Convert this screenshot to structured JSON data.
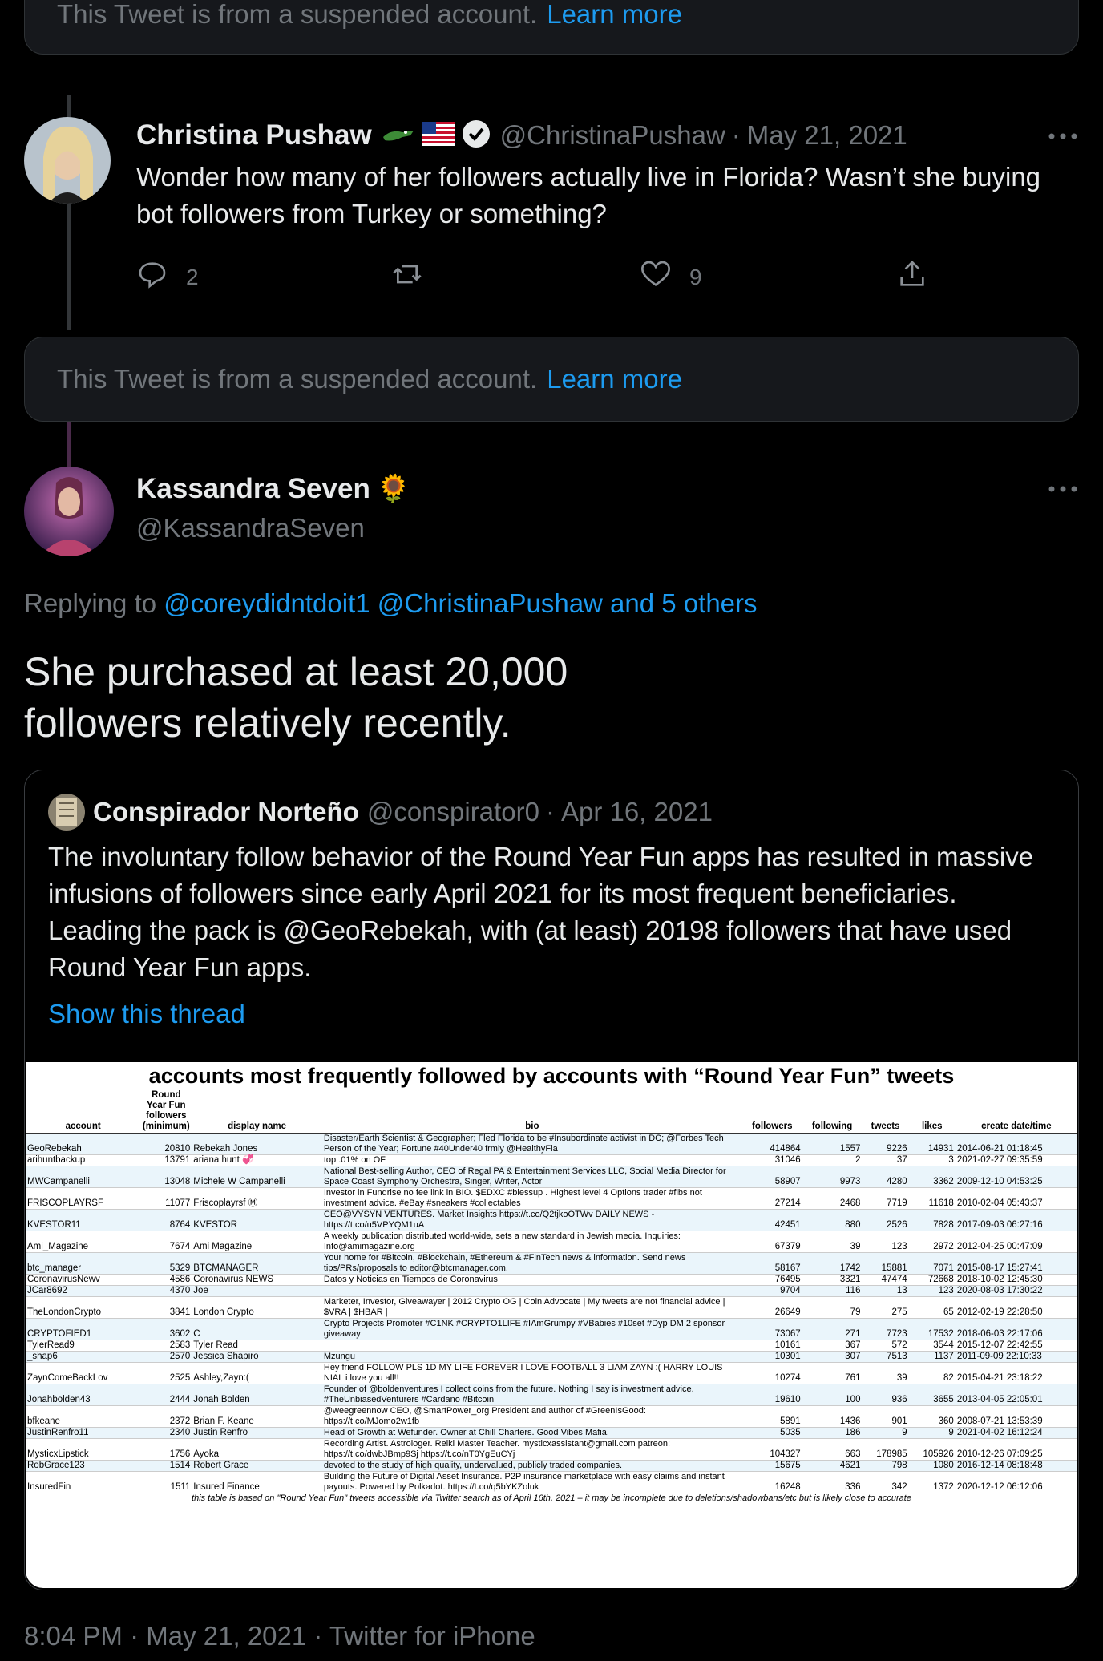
{
  "suspended_notice": {
    "text": "This Tweet is from a suspended account.",
    "link": "Learn more"
  },
  "tweet1": {
    "name": "Christina Pushaw",
    "handle": "@ChristinaPushaw",
    "date": "May 21, 2021",
    "text": "Wonder how many of her followers actually live in Florida? Wasn’t she buying bot followers from Turkey or something?",
    "replies": "2",
    "likes": "9"
  },
  "tweet2": {
    "name": "Kassandra Seven",
    "emoji": "🌻",
    "handle": "@KassandraSeven",
    "replying_label": "Replying to",
    "replying_to": "@coreydidntdoit1 @ChristinaPushaw and 5 others",
    "text_line1": "She purchased at least 20,000",
    "text_line2": "followers relatively recently.",
    "timestamp": "8:04 PM · May 21, 2021 · Twitter for iPhone"
  },
  "quote": {
    "name": "Conspirador Norteño",
    "handle": "@conspirator0",
    "date": "Apr 16, 2021",
    "text": "The involuntary follow behavior of the Round Year Fun apps has resulted in massive infusions of followers since early April 2021 for its most frequent beneficiaries. Leading the pack is @GeoRebekah, with (at least) 20198 followers that have used Round Year Fun apps.",
    "show_thread": "Show this thread"
  },
  "table": {
    "title": "accounts most frequently followed by accounts with “Round Year Fun” tweets",
    "headers": [
      "account",
      "Round Year Fun followers (minimum)",
      "display name",
      "bio",
      "followers",
      "following",
      "tweets",
      "likes",
      "create date/time"
    ],
    "rows": [
      [
        "GeoRebekah",
        "20810",
        "Rebekah Jones",
        "Disaster/Earth Scientist & Geographer; Fled Florida to be #Insubordinate activist in DC; @Forbes Tech Person of the Year; Fortune #40Under40 frmly @HealthyFla",
        "414864",
        "1557",
        "9226",
        "14931",
        "2014-06-21 01:18:45"
      ],
      [
        "arihuntbackup",
        "13791",
        "ariana hunt 💞",
        "top .01% on OF",
        "31046",
        "2",
        "37",
        "3",
        "2021-02-27 09:35:59"
      ],
      [
        "MWCampanelli",
        "13048",
        "Michele W Campanelli",
        "National Best-selling Author, CEO of Regal PA & Entertainment Services LLC, Social Media Director for Space Coast Symphony Orchestra, Singer, Writer, Actor",
        "58907",
        "9973",
        "4280",
        "3362",
        "2009-12-10 04:53:25"
      ],
      [
        "FRISCOPLAYRSF",
        "11077",
        "Friscoplayrsf Ⓜ",
        "Investor in Fundrise no fee link in BIO. $EDXC #blessup . Highest level 4 Options trader #fibs not investment advice. #eBay #sneakers #collectables",
        "27214",
        "2468",
        "7719",
        "11618",
        "2010-02-04 05:43:37"
      ],
      [
        "KVESTOR11",
        "8764",
        "KVESTOR",
        "CEO@VYSYN VENTURES. Market Insights https://t.co/Q2tjkoOTWv DAILY NEWS - https://t.co/u5VPYQM1uA",
        "42451",
        "880",
        "2526",
        "7828",
        "2017-09-03 06:27:16"
      ],
      [
        "Ami_Magazine",
        "7674",
        "Ami Magazine",
        "A weekly publication distributed world-wide, sets a new standard in Jewish media. Inquiries: Info@amimagazine.org",
        "67379",
        "39",
        "123",
        "2972",
        "2012-04-25 00:47:09"
      ],
      [
        "btc_manager",
        "5329",
        "BTCMANAGER",
        "Your home for #Bitcoin, #Blockchain, #Ethereum & #FinTech news & information. Send news tips/PRs/proposals to editor@btcmanager.com.",
        "58167",
        "1742",
        "15881",
        "7071",
        "2015-08-17 15:27:41"
      ],
      [
        "CoronavirusNewv",
        "4586",
        "Coronavirus NEWS",
        "Datos y Noticias en Tiempos de Coronavirus",
        "76495",
        "3321",
        "47474",
        "72668",
        "2018-10-02 12:45:30"
      ],
      [
        "JCar8692",
        "4370",
        "Joe",
        "",
        "9704",
        "116",
        "13",
        "123",
        "2020-08-03 17:30:22"
      ],
      [
        "TheLondonCrypto",
        "3841",
        "London Crypto",
        "Marketer, Investor, Giveawayer | 2012 Crypto OG | Coin Advocate | My tweets are not financial advice | $VRA | $HBAR |",
        "26649",
        "79",
        "275",
        "65",
        "2012-02-19 22:28:50"
      ],
      [
        "CRYPTOFIED1",
        "3602",
        "C",
        "Crypto Projects Promoter #C1NK #CRYPTO1LIFE #IAmGrumpy #VBabies #10set #Dyp DM 2 sponsor giveaway",
        "73067",
        "271",
        "7723",
        "17532",
        "2018-06-03 22:17:06"
      ],
      [
        "TylerRead9",
        "2583",
        "Tyler Read",
        "",
        "10161",
        "367",
        "572",
        "3544",
        "2015-12-07 22:42:55"
      ],
      [
        "_shap6",
        "2570",
        "Jessica Shapiro",
        "Mzungu",
        "10301",
        "307",
        "7513",
        "1137",
        "2011-09-09 22:10:33"
      ],
      [
        "ZaynComeBackLov",
        "2525",
        "Ashley,Zayn:(",
        "Hey friend FOLLOW PLS 1D MY LIFE FOREVER I LOVE FOOTBALL 3 LIAM ZAYN :( HARRY LOUIS NIAL i love you all!!",
        "10274",
        "761",
        "39",
        "82",
        "2015-04-21 23:18:22"
      ],
      [
        "Jonahbolden43",
        "2444",
        "Jonah Bolden",
        "Founder of @boldenventures I collect coins from the future. Nothing I say is investment advice. #TheUnbiasedVenturers #Cardano #Bitcoin",
        "19610",
        "100",
        "936",
        "3655",
        "2013-04-05 22:05:01"
      ],
      [
        "bfkeane",
        "2372",
        "Brian F. Keane",
        "@weegreennow CEO, @SmartPower_org President and author of #GreenIsGood: https://t.co/MJomo2w1fb",
        "5891",
        "1436",
        "901",
        "360",
        "2008-07-21 13:53:39"
      ],
      [
        "JustinRenfro11",
        "2340",
        "Justin Renfro",
        "Head of Growth at Wefunder. Owner at Chill Charters. Good Vibes Mafia.",
        "5035",
        "186",
        "9",
        "9",
        "2021-04-02 16:12:24"
      ],
      [
        "MysticxLipstick",
        "1756",
        "Ayoka",
        "Recording Artist. Astrologer. Reiki Master Teacher. mysticxassistant@gmail.com patreon: https://t.co/dwbJBmp9Sj https://t.co/nT0YgEuCYj",
        "104327",
        "663",
        "178985",
        "105926",
        "2010-12-26 07:09:25"
      ],
      [
        "RobGrace123",
        "1514",
        "Robert Grace",
        "devoted to the study of high quality, undervalued, publicly traded companies.",
        "15675",
        "4621",
        "798",
        "1080",
        "2016-12-14 08:18:48"
      ],
      [
        "InsuredFin",
        "1511",
        "Insured Finance",
        "Building the Future of Digital Asset Insurance. P2P insurance marketplace with easy claims and instant payouts. Powered by Polkadot. https://t.co/q5bYKZoluk",
        "16248",
        "336",
        "342",
        "1372",
        "2020-12-12 06:12:06"
      ]
    ],
    "footnote": "this table is based on \"Round Year Fun\" tweets accessible via Twitter search as of April 16th, 2021 – it may be incomplete due to deletions/shadowbans/etc but is likely close to accurate"
  },
  "icons": {
    "reply": "reply-icon",
    "retweet": "retweet-icon",
    "like": "heart-icon",
    "share": "share-icon",
    "more": "more-icon",
    "verified": "verified-badge-icon",
    "flag": "us-flag-icon",
    "gator": "alligator-icon"
  },
  "colors": {
    "accent": "#1d9bf0",
    "muted": "#71767b",
    "background": "#000000",
    "card": "#16181c"
  }
}
